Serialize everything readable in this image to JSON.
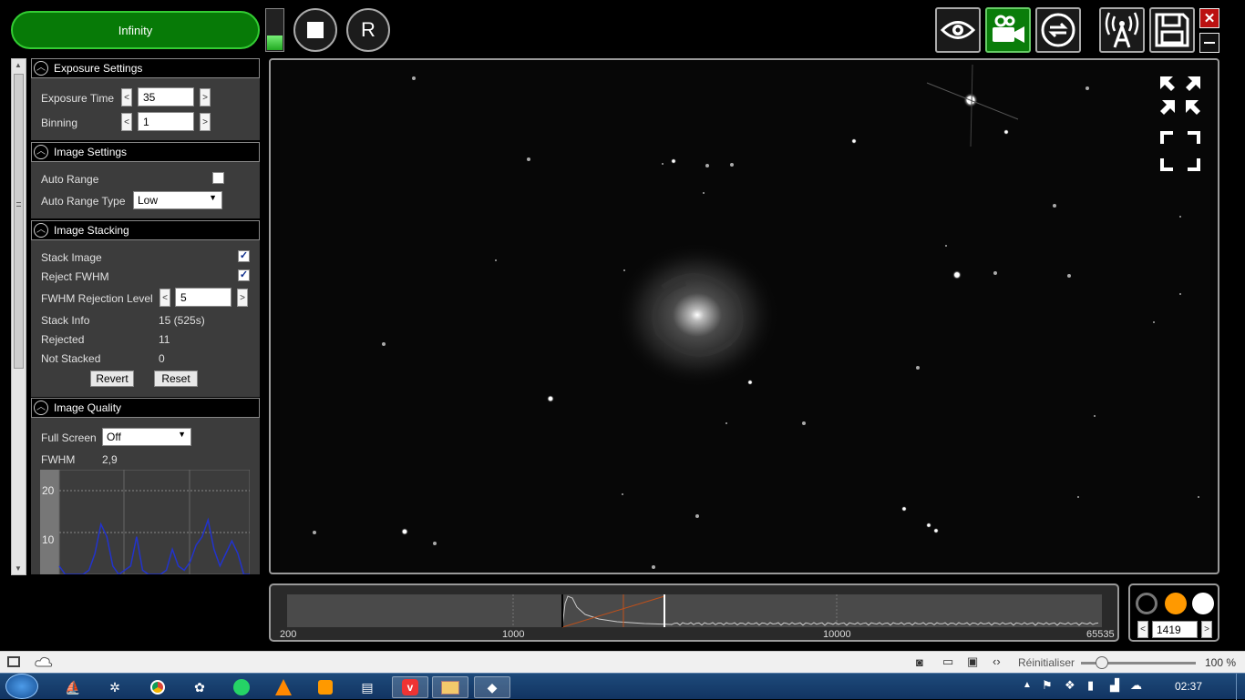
{
  "header": {
    "camera_name": "Infinity",
    "level_percent": 35,
    "stop_label": "■",
    "reset_label": "R",
    "buttons": [
      "eye-icon",
      "video-camera-icon",
      "loop-icon",
      "antenna-icon",
      "save-icon"
    ],
    "close_label": "✕"
  },
  "exposure": {
    "title": "Exposure Settings",
    "time_label": "Exposure Time",
    "time_value": "35",
    "binning_label": "Binning",
    "binning_value": "1"
  },
  "image_settings": {
    "title": "Image Settings",
    "auto_range_label": "Auto Range",
    "auto_range_checked": false,
    "auto_range_type_label": "Auto Range Type",
    "auto_range_type_value": "Low"
  },
  "stacking": {
    "title": "Image Stacking",
    "stack_image_label": "Stack Image",
    "stack_image_checked": true,
    "reject_fwhm_label": "Reject FWHM",
    "reject_fwhm_checked": true,
    "fwhm_level_label": "FWHM Rejection Level",
    "fwhm_level_value": "5",
    "stack_info_label": "Stack Info",
    "stack_info_value": "15 (525s)",
    "rejected_label": "Rejected",
    "rejected_value": "11",
    "not_stacked_label": "Not Stacked",
    "not_stacked_value": "0",
    "revert_label": "Revert",
    "reset_label": "Reset"
  },
  "quality": {
    "title": "Image Quality",
    "full_screen_label": "Full Screen",
    "full_screen_value": "Off",
    "fwhm_label": "FWHM",
    "fwhm_value": "2,9",
    "chart_tick_20": "20",
    "chart_tick_10": "10"
  },
  "chart_data": {
    "type": "line",
    "ylim": [
      0,
      25
    ],
    "yticks": [
      10,
      20
    ],
    "series": [
      {
        "values": [
          2,
          0,
          0,
          0,
          0,
          1,
          5,
          12,
          9,
          2,
          0,
          1,
          2,
          9,
          1,
          0,
          0,
          0,
          1,
          6,
          2,
          1,
          3,
          7,
          9,
          13,
          6,
          2,
          5,
          8,
          5,
          0,
          0
        ]
      }
    ]
  },
  "histogram": {
    "labels": [
      "200",
      "1000",
      "10000",
      "65535"
    ],
    "min_value": 200,
    "max_value": 65535,
    "black_point": 1419
  },
  "display": {
    "stretch_value": "1419",
    "colors": {
      "black": "#000000",
      "orange": "#ff9900",
      "white": "#ffffff"
    }
  },
  "status_bar": {
    "reset_label": "Réinitialiser",
    "zoom": "100 %"
  },
  "taskbar": {
    "clock": "02:37"
  }
}
